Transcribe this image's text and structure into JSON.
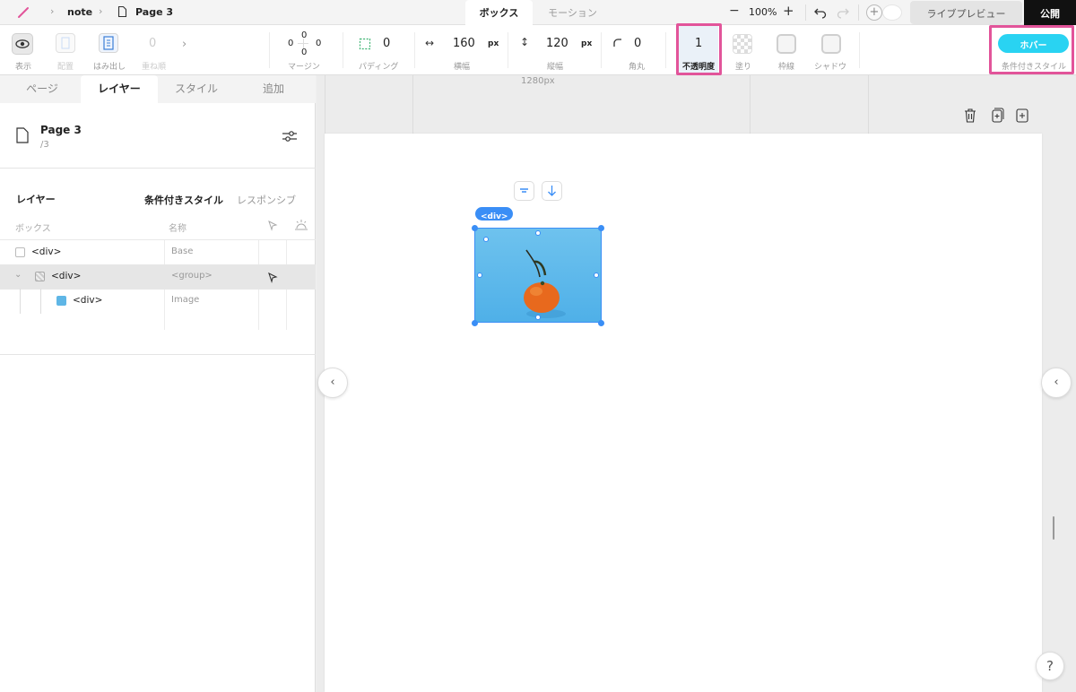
{
  "topbar": {
    "project": "note",
    "page": "Page 3",
    "tabs": [
      "ボックス",
      "モーション"
    ],
    "zoom": "100%",
    "zoom_out": "−",
    "zoom_in": "+",
    "live_preview": "ライブプレビュー",
    "publish": "公開"
  },
  "toolbar": {
    "show_label": "表示",
    "place_label": "配置",
    "overflow_label": "はみ出し",
    "rotate_value": "0",
    "rotate_label": "重ね順",
    "margin": {
      "top": "0",
      "left": "0",
      "right": "0",
      "bottom": "0",
      "label": "マージン"
    },
    "padding": {
      "value": "0",
      "label": "パディング"
    },
    "width": {
      "value": "160",
      "unit": "px",
      "label": "横幅"
    },
    "height": {
      "value": "120",
      "unit": "px",
      "label": "縦幅"
    },
    "radius": {
      "value": "0",
      "label": "角丸"
    },
    "opacity": {
      "value": "1",
      "label": "不透明度"
    },
    "fill_label": "塗り",
    "border_label": "枠線",
    "shadow_label": "シャドウ",
    "hover_button": "ホバー",
    "conditional_label": "条件付きスタイル",
    "accent": "#29d3f2",
    "highlight": "#e2549a"
  },
  "panel": {
    "tabs": [
      "ページ",
      "レイヤー",
      "スタイル",
      "追加"
    ],
    "page_name": "Page 3",
    "page_path": "/3",
    "layers_title": "レイヤー",
    "conditional_tab": "条件付きスタイル",
    "responsive_tab": "レスポンシブ",
    "col_box": "ボックス",
    "col_name": "名称",
    "rows": [
      {
        "box": "<div>",
        "name": "Base"
      },
      {
        "box": "<div>",
        "name": "<group>"
      },
      {
        "box": "<div>",
        "name": "Image"
      }
    ]
  },
  "canvas": {
    "width_label": "1280px",
    "element_tag": "<div>",
    "help": "?"
  }
}
